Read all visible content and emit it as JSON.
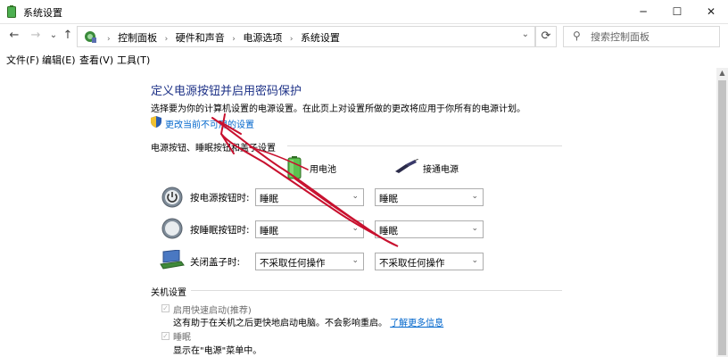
{
  "window": {
    "title": "系统设置"
  },
  "window_controls": {
    "minimize": "─",
    "maximize": "☐",
    "close": "✕"
  },
  "nav": {
    "back": "←",
    "forward": "→",
    "recent": "⌄",
    "up": "↑",
    "refresh": "⟳"
  },
  "address": {
    "crumbs": [
      "控制面板",
      "硬件和声音",
      "电源选项",
      "系统设置"
    ],
    "separator": "›"
  },
  "search": {
    "placeholder": "搜索控制面板"
  },
  "menu": [
    "文件(F)",
    "编辑(E)",
    "查看(V)",
    "工具(T)"
  ],
  "main": {
    "heading": "定义电源按钮并启用密码保护",
    "description": "选择要为你的计算机设置的电源设置。在此页上对设置所做的更改将应用于你所有的电源计划。",
    "change_link": "更改当前不可用的设置",
    "buttons_section": "电源按钮、睡眠按钮和盖子设置",
    "col_battery": "用电池",
    "col_plugged": "接通电源",
    "rows": [
      {
        "label": "按电源按钮时:",
        "battery": "睡眠",
        "plugged": "睡眠"
      },
      {
        "label": "按睡眠按钮时:",
        "battery": "睡眠",
        "plugged": "睡眠"
      },
      {
        "label": "关闭盖子时:",
        "battery": "不采取任何操作",
        "plugged": "不采取任何操作"
      }
    ],
    "shutdown_section": "关机设置",
    "fast_startup": {
      "label": "启用快速启动(推荐)",
      "note": "这有助于在关机之后更快地启动电脑。不会影响重启。",
      "link": "了解更多信息",
      "checked": true
    },
    "sleep": {
      "label": "睡眠",
      "note": "显示在\"电源\"菜单中。",
      "checked": true
    }
  },
  "colors": {
    "heading": "#1e3287",
    "link": "#0066cc",
    "annotation": "#c8102e"
  },
  "icons": [
    "control-panel-icon",
    "shield-icon",
    "battery-icon",
    "plug-icon",
    "power-button-icon",
    "sleep-button-icon",
    "laptop-lid-icon",
    "search-icon"
  ]
}
